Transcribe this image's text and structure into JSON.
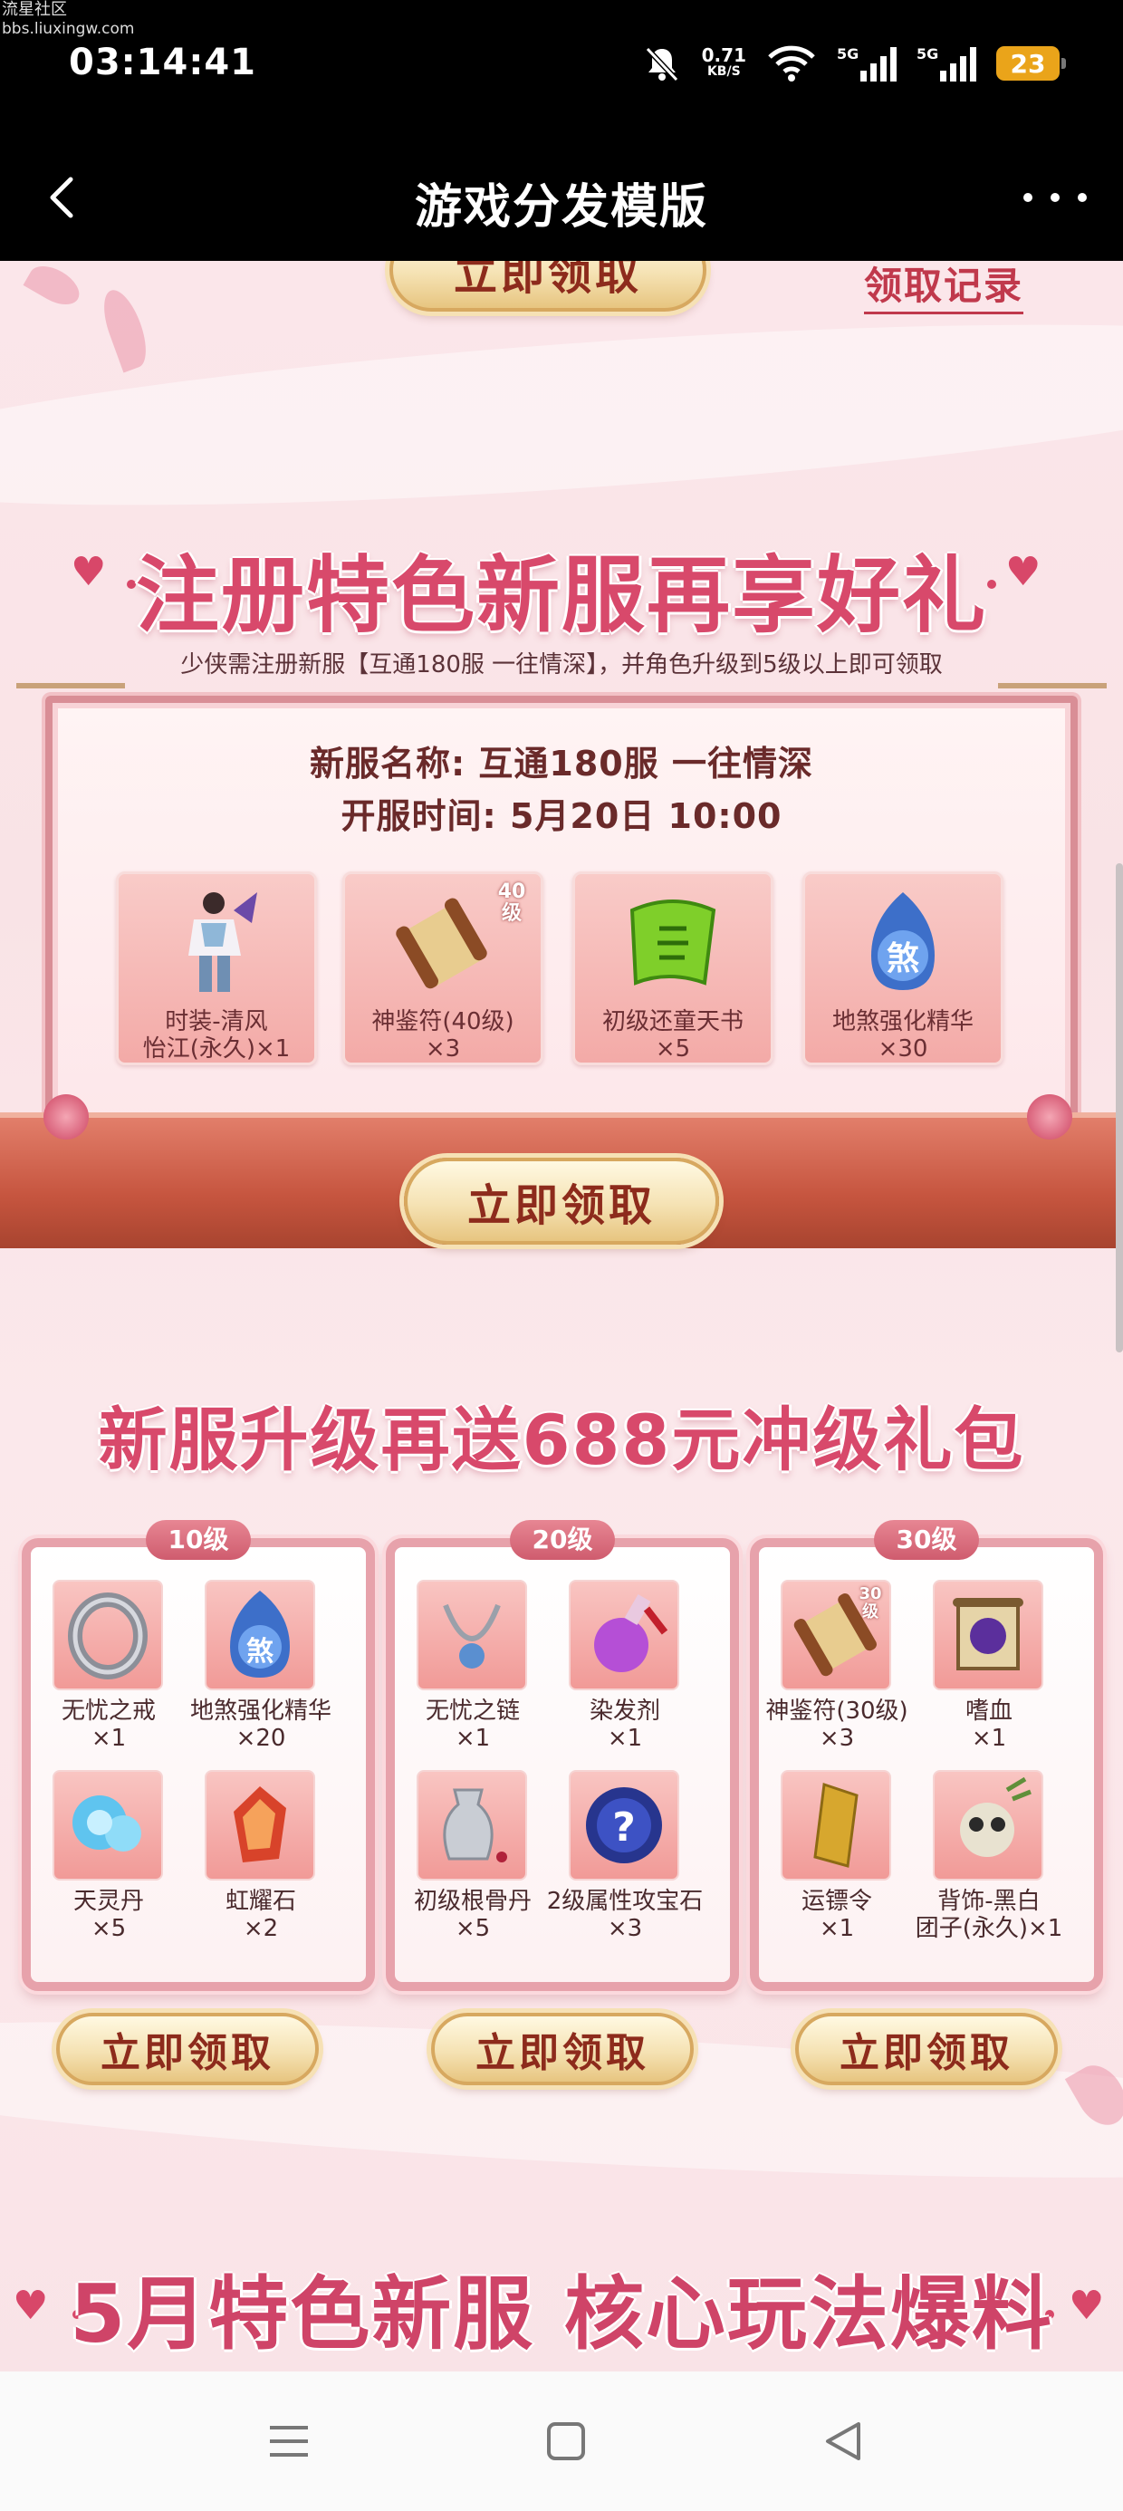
{
  "status_bar": {
    "watermark_name": "流星社区",
    "watermark_url": "bbs.liuxingw.com",
    "time": "03:14:41",
    "net_speed": "0.71",
    "net_unit": "KB/S",
    "signal1": "5G",
    "signal2": "5G",
    "battery": "23"
  },
  "nav": {
    "title": "游戏分发模版"
  },
  "top": {
    "claim_button": "立即领取",
    "record_link": "领取记录"
  },
  "register_section": {
    "title": "注册特色新服再享好礼",
    "desc": "少侠需注册新服【互通180服 一往情深】，并角色升级到5级以上即可领取",
    "server_name": "新服名称: 互通180服  一往情深",
    "open_time": "开服时间: 5月20日  10:00",
    "rewards": [
      {
        "name": "时装-清风",
        "qty": "怡江(永久)×1"
      },
      {
        "name": "神鉴符(40级)",
        "qty": "×3",
        "badge": "40级"
      },
      {
        "name": "初级还童天书",
        "qty": "×5"
      },
      {
        "name": "地煞强化精华",
        "qty": "×30",
        "glyph": "煞"
      }
    ],
    "claim_button": "立即领取"
  },
  "upgrade_section": {
    "title": "新服升级再送688元冲级礼包",
    "packs": [
      {
        "level": "10级",
        "items": [
          {
            "name": "无忧之戒",
            "qty": "×1"
          },
          {
            "name": "地煞强化精华",
            "qty": "×20",
            "glyph": "煞"
          },
          {
            "name": "天灵丹",
            "qty": "×5"
          },
          {
            "name": "虹耀石",
            "qty": "×2"
          }
        ],
        "button": "立即领取"
      },
      {
        "level": "20级",
        "items": [
          {
            "name": "无忧之链",
            "qty": "×1"
          },
          {
            "name": "染发剂",
            "qty": "×1"
          },
          {
            "name": "初级根骨丹",
            "qty": "×5"
          },
          {
            "name": "2级属性攻宝石",
            "qty": "×3",
            "glyph": "?"
          }
        ],
        "button": "立即领取"
      },
      {
        "level": "30级",
        "items": [
          {
            "name": "神鉴符(30级)",
            "qty": "×3",
            "badge": "30级"
          },
          {
            "name": "嗜血",
            "qty": "×1"
          },
          {
            "name": "运镖令",
            "qty": "×1"
          },
          {
            "name": "背饰-黑白",
            "qty": "团子(永久)×1"
          }
        ],
        "button": "立即领取"
      }
    ]
  },
  "bottom_section": {
    "title": "5月特色新服 核心玩法爆料"
  },
  "colors": {
    "accent_pink": "#d8496b",
    "gold": "#e7c580",
    "button_text": "#8d2b1c",
    "stage": "#c6553f"
  }
}
